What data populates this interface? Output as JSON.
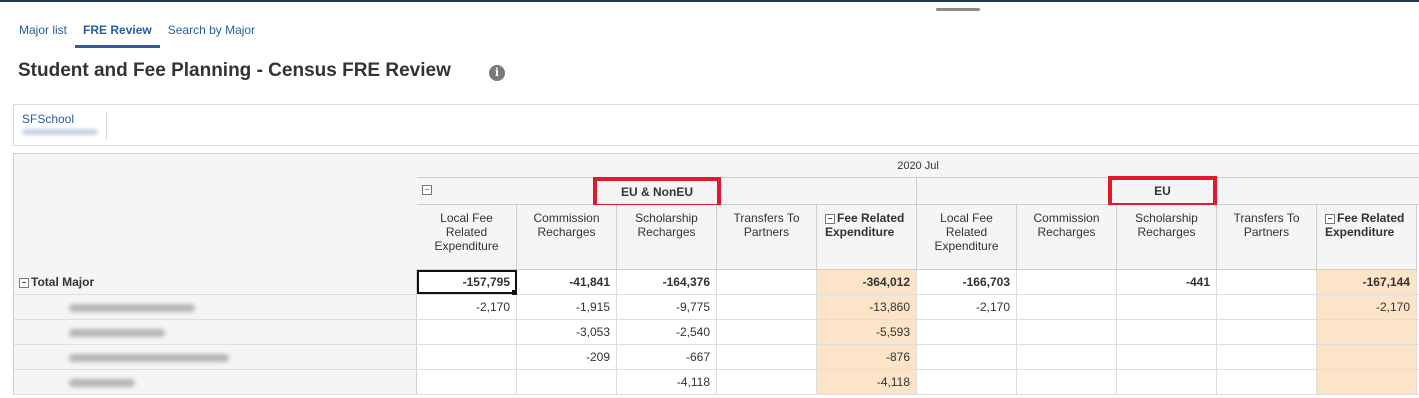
{
  "tabs": [
    {
      "label": "Major list"
    },
    {
      "label": "FRE Review"
    },
    {
      "label": "Search by Major"
    }
  ],
  "title": "Student and Fee Planning - Census FRE Review",
  "info_icon": "info-icon",
  "prompt": {
    "label": "SFSchool"
  },
  "period": "2020 Jul",
  "groups": [
    {
      "name": "EU & NonEU"
    },
    {
      "name": "EU"
    }
  ],
  "columns": [
    "Local Fee Related Expenditure",
    "Commission Recharges",
    "Scholarship Recharges",
    "Transfers To Partners",
    "Fee Related Expenditure",
    "Local Fee Related Expenditure",
    "Commission Recharges",
    "Scholarship Recharges",
    "Transfers To Partners",
    "Fee Related Expenditure"
  ],
  "total_row": {
    "label": "Total Major",
    "values": [
      "-157,795",
      "-41,841",
      "-164,376",
      "",
      "-364,012",
      "-166,703",
      "",
      "-441",
      "",
      "-167,144"
    ]
  },
  "rows": [
    {
      "values": [
        "-2,170",
        "-1,915",
        "-9,775",
        "",
        "-13,860",
        "-2,170",
        "",
        "",
        "",
        "-2,170"
      ]
    },
    {
      "values": [
        "",
        "-3,053",
        "-2,540",
        "",
        "-5,593",
        "",
        "",
        "",
        "",
        ""
      ]
    },
    {
      "values": [
        "",
        "-209",
        "-667",
        "",
        "-876",
        "",
        "",
        "",
        "",
        ""
      ]
    },
    {
      "values": [
        "",
        "",
        "-4,118",
        "",
        "-4,118",
        "",
        "",
        "",
        "",
        ""
      ]
    }
  ],
  "colors": {
    "accent": "#2a5d9e",
    "fre_bg": "#fce4c8",
    "highlight": "#e3182d"
  }
}
